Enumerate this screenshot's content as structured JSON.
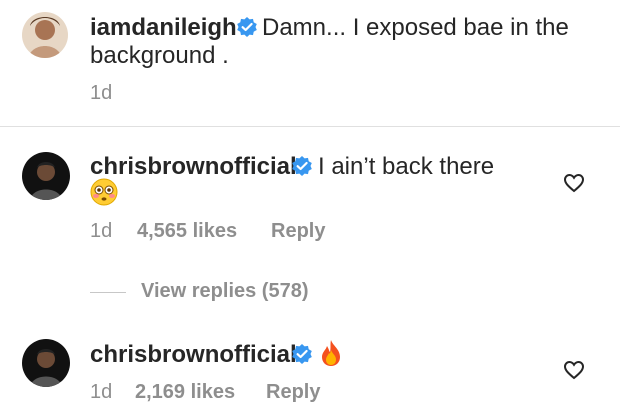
{
  "comments": [
    {
      "username": "iamdanileigh",
      "text_line1": "Damn... I exposed bae in the",
      "text_line2": "background .",
      "time": "1d"
    },
    {
      "username": "chrisbrownofficial",
      "text": "I ain’t back there",
      "emoji": "flushed-face",
      "time": "1d",
      "likes": "4,565 likes",
      "reply": "Reply",
      "view_replies": "View replies (578)"
    },
    {
      "username": "chrisbrownofficial",
      "emoji": "fire",
      "time": "1d",
      "likes": "2,169 likes",
      "reply": "Reply"
    }
  ],
  "colors": {
    "text": "#262626",
    "muted": "#8e8e8e",
    "verified": "#3897f0"
  }
}
